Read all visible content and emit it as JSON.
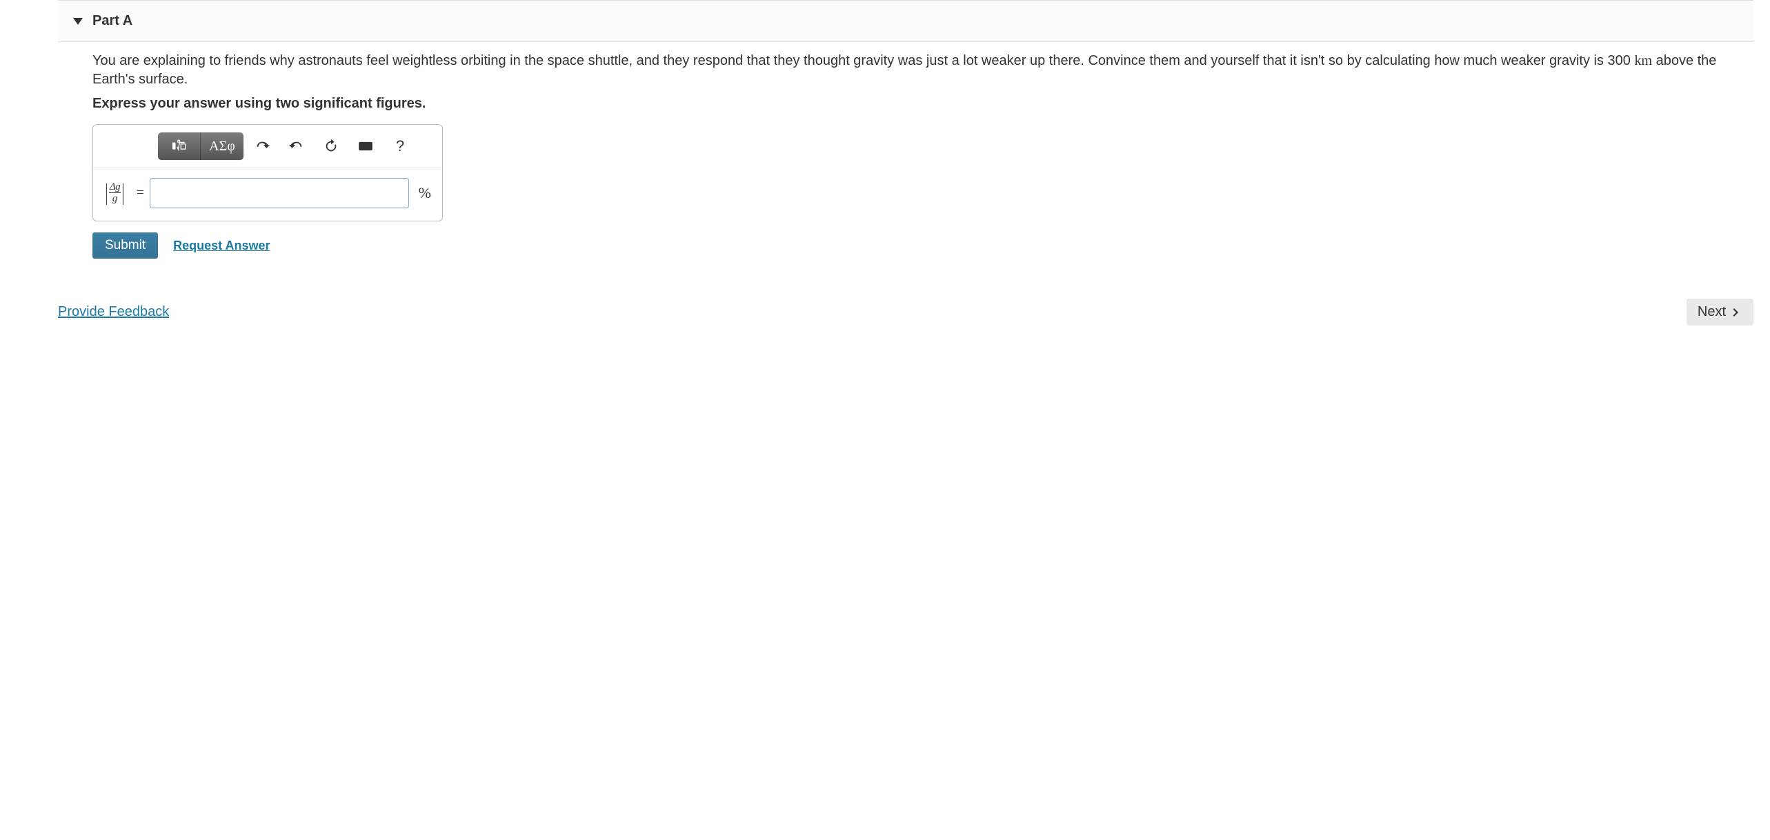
{
  "part": {
    "title": "Part A",
    "prompt_before_value": "You are explaining to friends why astronauts feel weightless orbiting in the space shuttle, and they respond that they thought gravity was just a lot weaker up there. Convince them and yourself that it isn't so by calculating how much weaker gravity is ",
    "prompt_value": "300",
    "prompt_unit": "km",
    "prompt_after_value": " above the Earth's surface.",
    "instruction": "Express your answer using two significant figures."
  },
  "toolbar": {
    "templates_label": "Templates",
    "symbols_label": "ΑΣφ",
    "undo_label": "undo",
    "redo_label": "redo",
    "reset_label": "reset",
    "keyboard_label": "keyboard",
    "help_label": "?"
  },
  "answer": {
    "lhs_numerator": "Δg",
    "lhs_denominator": "g",
    "equals": "=",
    "value": "",
    "unit": "%"
  },
  "actions": {
    "submit": "Submit",
    "request_answer": "Request Answer"
  },
  "footer": {
    "feedback": "Provide Feedback",
    "next": "Next"
  }
}
